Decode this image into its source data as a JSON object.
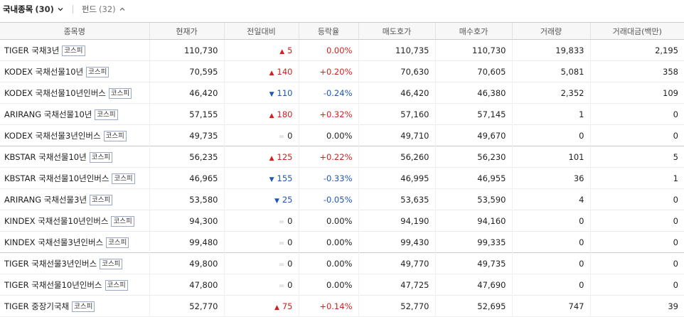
{
  "tabs": [
    {
      "label": "국내종목",
      "count": "(30)"
    },
    {
      "label": "펀드",
      "count": "(32)"
    }
  ],
  "colors": {
    "up": "#d21f1f",
    "down": "#1d56b8"
  },
  "table": {
    "headers": [
      "종목명",
      "현재가",
      "전일대비",
      "등락율",
      "매도호가",
      "매수호가",
      "거래량",
      "거래대금(백만)"
    ],
    "rows": [
      {
        "name": "TIGER 국채3년",
        "market": "코스피",
        "price": "110,730",
        "dir": "up",
        "change": "5",
        "rate": "0.00%",
        "ask": "110,735",
        "bid": "110,730",
        "volume": "19,833",
        "amount": "2,195"
      },
      {
        "name": "KODEX 국채선물10년",
        "market": "코스피",
        "price": "70,595",
        "dir": "up",
        "change": "140",
        "rate": "+0.20%",
        "ask": "70,630",
        "bid": "70,605",
        "volume": "5,081",
        "amount": "358"
      },
      {
        "name": "KODEX 국채선물10년인버스",
        "market": "코스피",
        "price": "46,420",
        "dir": "down",
        "change": "110",
        "rate": "-0.24%",
        "ask": "46,420",
        "bid": "46,380",
        "volume": "2,352",
        "amount": "109"
      },
      {
        "name": "ARIRANG 국채선물10년",
        "market": "코스피",
        "price": "57,155",
        "dir": "up",
        "change": "180",
        "rate": "+0.32%",
        "ask": "57,160",
        "bid": "57,145",
        "volume": "1",
        "amount": "0"
      },
      {
        "name": "KODEX 국채선물3년인버스",
        "market": "코스피",
        "price": "49,735",
        "dir": "flat",
        "change": "0",
        "rate": "0.00%",
        "ask": "49,710",
        "bid": "49,670",
        "volume": "0",
        "amount": "0"
      },
      {
        "name": "KBSTAR 국채선물10년",
        "market": "코스피",
        "price": "56,235",
        "dir": "up",
        "change": "125",
        "rate": "+0.22%",
        "ask": "56,260",
        "bid": "56,230",
        "volume": "101",
        "amount": "5"
      },
      {
        "name": "KBSTAR 국채선물10년인버스",
        "market": "코스피",
        "price": "46,965",
        "dir": "down",
        "change": "155",
        "rate": "-0.33%",
        "ask": "46,995",
        "bid": "46,955",
        "volume": "36",
        "amount": "1"
      },
      {
        "name": "ARIRANG 국채선물3년",
        "market": "코스피",
        "price": "53,580",
        "dir": "down",
        "change": "25",
        "rate": "-0.05%",
        "ask": "53,635",
        "bid": "53,590",
        "volume": "4",
        "amount": "0"
      },
      {
        "name": "KINDEX 국채선물10년인버스",
        "market": "코스피",
        "price": "94,300",
        "dir": "flat",
        "change": "0",
        "rate": "0.00%",
        "ask": "94,190",
        "bid": "94,160",
        "volume": "0",
        "amount": "0"
      },
      {
        "name": "KINDEX 국채선물3년인버스",
        "market": "코스피",
        "price": "99,480",
        "dir": "flat",
        "change": "0",
        "rate": "0.00%",
        "ask": "99,430",
        "bid": "99,335",
        "volume": "0",
        "amount": "0"
      },
      {
        "name": "TIGER 국채선물3년인버스",
        "market": "코스피",
        "price": "49,800",
        "dir": "flat",
        "change": "0",
        "rate": "0.00%",
        "ask": "49,770",
        "bid": "49,735",
        "volume": "0",
        "amount": "0"
      },
      {
        "name": "TIGER 국채선물10년인버스",
        "market": "코스피",
        "price": "47,800",
        "dir": "flat",
        "change": "0",
        "rate": "0.00%",
        "ask": "47,725",
        "bid": "47,690",
        "volume": "0",
        "amount": "0"
      },
      {
        "name": "TIGER 중장기국채",
        "market": "코스피",
        "price": "52,770",
        "dir": "up",
        "change": "75",
        "rate": "+0.14%",
        "ask": "52,770",
        "bid": "52,695",
        "volume": "747",
        "amount": "39"
      }
    ]
  }
}
